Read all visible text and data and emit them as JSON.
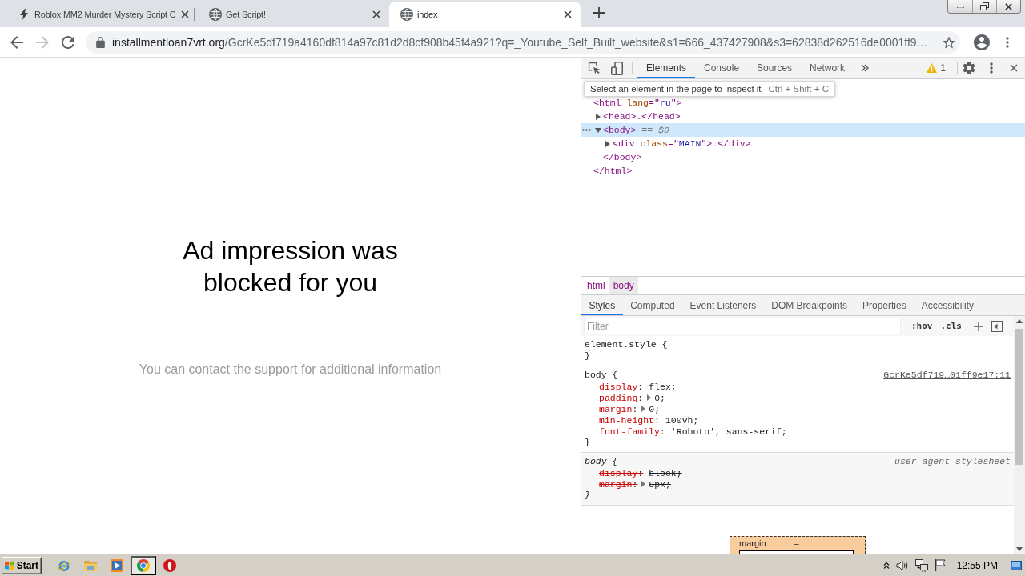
{
  "browser": {
    "tabs": [
      {
        "kind": "bolt",
        "title": "Roblox MM2 Murder Mystery Script C",
        "selected": false
      },
      {
        "kind": "globe",
        "title": "Get Script!",
        "selected": false
      },
      {
        "kind": "globe",
        "title": "index",
        "selected": true
      }
    ],
    "nav_buttons": [
      {
        "kind": "back",
        "disabled": false
      },
      {
        "kind": "forward",
        "disabled": true
      },
      {
        "kind": "reload",
        "disabled": false
      }
    ],
    "url": {
      "domain": "installmentloan7vrt.org",
      "path": "/GcrKe5df719a4160df814a97c81d2d8cf908b45f4a921?q=_Youtube_Self_Built_website&s1=666_437427908&s3=62838d262516de0001ff9…"
    }
  },
  "page": {
    "heading": "Ad impression was blocked for you",
    "note": "You can contact the support for additional information"
  },
  "devtools": {
    "tabs": [
      {
        "label": "Elements",
        "selected": true
      },
      {
        "label": "Console",
        "selected": false
      },
      {
        "label": "Sources",
        "selected": false
      },
      {
        "label": "Network",
        "selected": false
      }
    ],
    "warning_count": "1",
    "tooltip": {
      "text": "Select an element in the page to inspect it",
      "shortcut": "Ctrl + Shift + C"
    },
    "dom_tree": [
      {
        "selected": false,
        "parts": [
          {
            "kind": "tag",
            "text": "<html"
          },
          {
            "kind": "attr",
            "text": " lang"
          },
          {
            "kind": "punct",
            "text": "=\""
          },
          {
            "kind": "value",
            "text": "ru"
          },
          {
            "kind": "punct",
            "text": "\">"
          }
        ],
        "children": [
          {
            "selected": false,
            "expanded": false,
            "parts": [
              {
                "kind": "tag",
                "text": "<head>"
              },
              {
                "kind": "ellipsis",
                "text": "…"
              },
              {
                "kind": "tag",
                "text": "</head>"
              }
            ]
          },
          {
            "selected": true,
            "expanded": true,
            "parts": [
              {
                "kind": "tag",
                "text": "<body>"
              },
              {
                "kind": "marker",
                "text": " == "
              },
              {
                "kind": "var",
                "text": "$0"
              }
            ],
            "children": [
              {
                "selected": false,
                "expanded": false,
                "parts": [
                  {
                    "kind": "tag",
                    "text": "<div"
                  },
                  {
                    "kind": "attr",
                    "text": " class"
                  },
                  {
                    "kind": "punct",
                    "text": "=\""
                  },
                  {
                    "kind": "value",
                    "text": "MAIN"
                  },
                  {
                    "kind": "punct",
                    "text": "\">"
                  },
                  {
                    "kind": "ellipsis",
                    "text": "…"
                  },
                  {
                    "kind": "tag",
                    "text": "</div>"
                  }
                ]
              }
            ],
            "closing": "</body>"
          }
        ],
        "closing": "</html>"
      }
    ],
    "breadcrumbs": [
      {
        "label": "html",
        "selected": false
      },
      {
        "label": "body",
        "selected": true
      }
    ],
    "panel_tabs": [
      {
        "label": "Styles",
        "selected": true
      },
      {
        "label": "Computed",
        "selected": false
      },
      {
        "label": "Event Listeners",
        "selected": false
      },
      {
        "label": "DOM Breakpoints",
        "selected": false
      },
      {
        "label": "Properties",
        "selected": false
      },
      {
        "label": "Accessibility",
        "selected": false
      }
    ],
    "filter": {
      "placeholder": "Filter",
      "toggles": [
        ":hov",
        ".cls"
      ]
    },
    "rules": [
      {
        "kind": "inline",
        "header": "element.style {",
        "footer": "}"
      },
      {
        "kind": "author",
        "header": "body {",
        "source": "GcrKe5df719…01ff9e17:11",
        "properties": [
          {
            "name": "display",
            "colon": ":",
            "value": "flex;",
            "expandable": false,
            "overridden": false
          },
          {
            "name": "padding",
            "colon": ":",
            "value": "0;",
            "expandable": true,
            "overridden": false
          },
          {
            "name": "margin",
            "colon": ":",
            "value": "0;",
            "expandable": true,
            "overridden": false
          },
          {
            "name": "min-height",
            "colon": ":",
            "value": "100vh;",
            "expandable": false,
            "overridden": false
          },
          {
            "name": "font-family",
            "colon": ":",
            "value": "'Roboto', sans-serif;",
            "expandable": false,
            "overridden": false
          }
        ],
        "footer": "}"
      },
      {
        "kind": "user_agent",
        "header": "body {",
        "source": "user agent stylesheet",
        "properties": [
          {
            "name": "display",
            "colon": ":",
            "value": "block;",
            "expandable": false,
            "overridden": true
          },
          {
            "name": "margin",
            "colon": ":",
            "value": "8px;",
            "expandable": true,
            "overridden": true
          }
        ],
        "footer": "}"
      }
    ],
    "box_model": {
      "label": "margin",
      "value": "–"
    }
  },
  "taskbar": {
    "start": "Start",
    "apps": [
      {
        "kind": "ie",
        "selected": false
      },
      {
        "kind": "folder",
        "selected": false
      },
      {
        "kind": "media",
        "selected": false
      },
      {
        "kind": "chrome",
        "selected": true
      },
      {
        "kind": "red_ring",
        "selected": false
      }
    ],
    "clock": "12:55 PM"
  }
}
